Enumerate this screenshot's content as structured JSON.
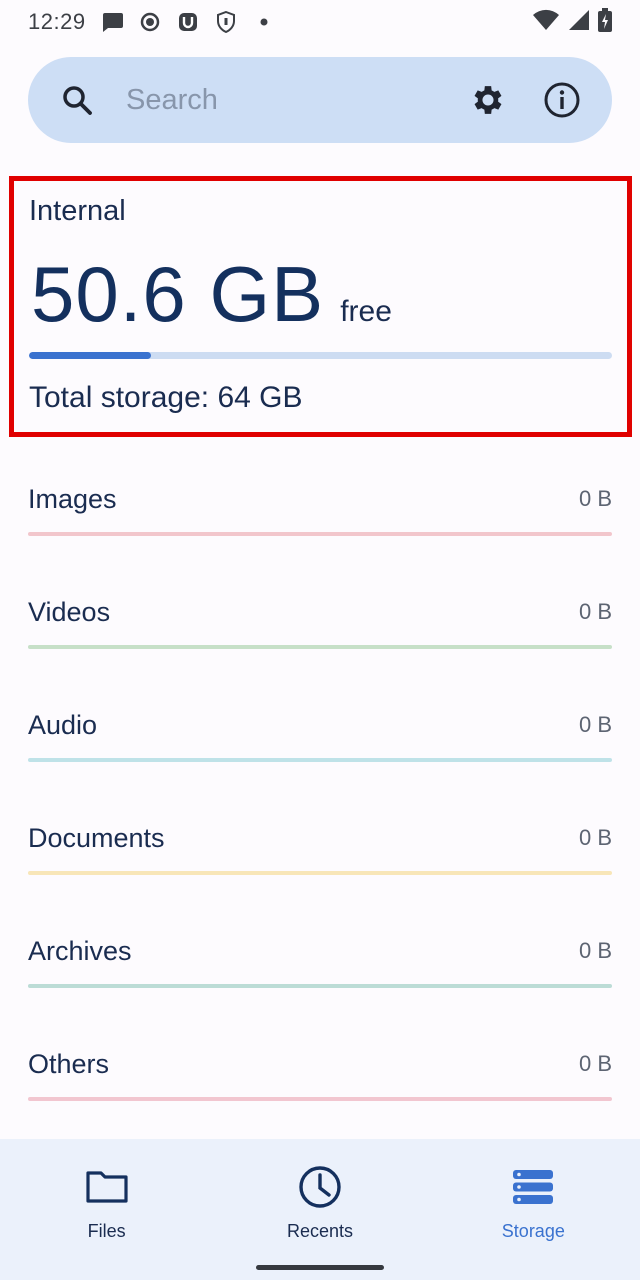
{
  "status_bar": {
    "time": "12:29",
    "left_icons": [
      "message-icon",
      "record-icon",
      "magnet-icon",
      "vpn-shield-icon",
      "dot-icon"
    ],
    "right_icons": [
      "wifi-icon",
      "signal-icon",
      "battery-charging-icon"
    ]
  },
  "search": {
    "placeholder": "Search",
    "icon": "search-icon",
    "actions": [
      "settings-gear-icon",
      "info-icon"
    ]
  },
  "storage": {
    "label": "Internal",
    "free_value": "50.6 GB",
    "free_suffix": "free",
    "used_fraction": 0.21,
    "total_text": "Total storage: 64 GB",
    "accent_color": "#3a72cf"
  },
  "categories": [
    {
      "name": "Images",
      "size": "0 B",
      "color": "#f2c6cc"
    },
    {
      "name": "Videos",
      "size": "0 B",
      "color": "#c7e0c8"
    },
    {
      "name": "Audio",
      "size": "0 B",
      "color": "#bfe2e8"
    },
    {
      "name": "Documents",
      "size": "0 B",
      "color": "#f8e6b8"
    },
    {
      "name": "Archives",
      "size": "0 B",
      "color": "#bcdcd6"
    },
    {
      "name": "Others",
      "size": "0 B",
      "color": "#f2c6d0"
    }
  ],
  "bottom_nav": [
    {
      "label": "Files",
      "icon": "folder-icon",
      "active": false
    },
    {
      "label": "Recents",
      "icon": "clock-icon",
      "active": false
    },
    {
      "label": "Storage",
      "icon": "storage-icon",
      "active": true
    }
  ]
}
